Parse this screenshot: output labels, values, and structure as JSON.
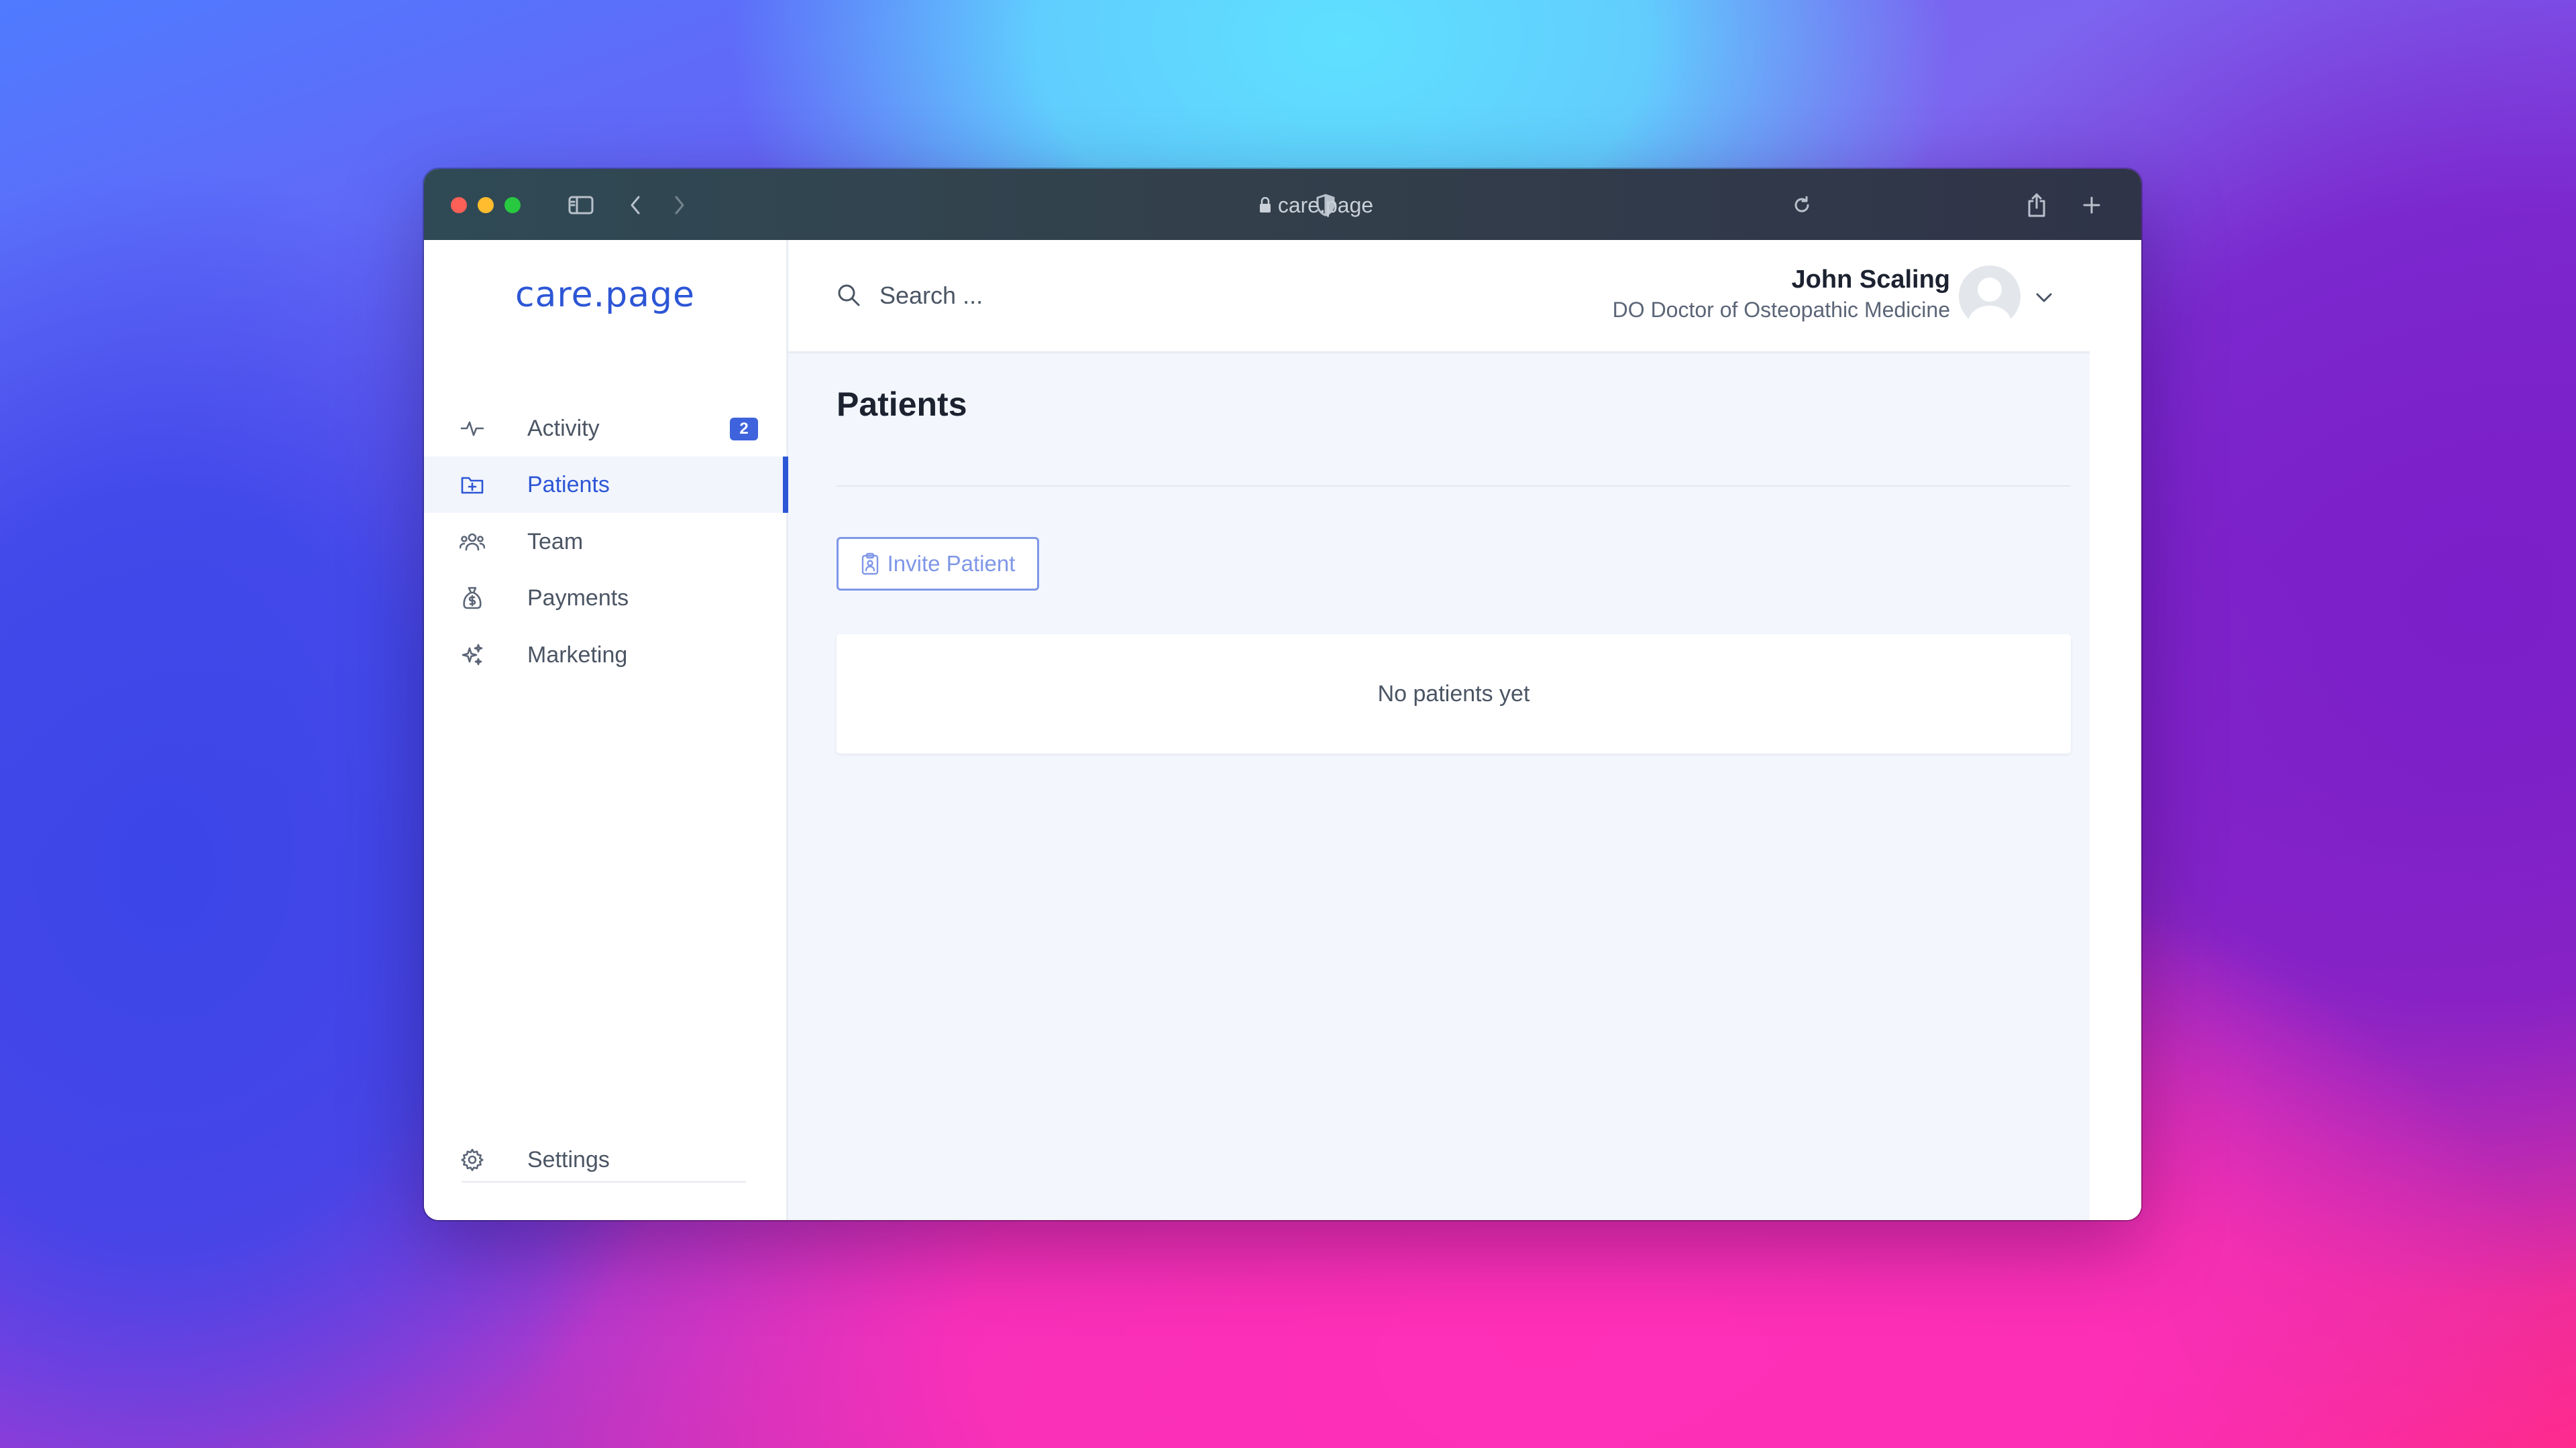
{
  "browser": {
    "url": "care.page"
  },
  "sidebar": {
    "logo": "care.page",
    "items": [
      {
        "label": "Activity",
        "icon": "pulse-icon",
        "badge": "2"
      },
      {
        "label": "Patients",
        "icon": "folder-plus-icon",
        "active": true
      },
      {
        "label": "Team",
        "icon": "users-icon"
      },
      {
        "label": "Payments",
        "icon": "money-bag-icon"
      },
      {
        "label": "Marketing",
        "icon": "sparkles-icon"
      }
    ],
    "settings_label": "Settings"
  },
  "header": {
    "search_placeholder": "Search ...",
    "user_name": "John Scaling",
    "user_role": "DO Doctor of Osteopathic Medicine"
  },
  "main": {
    "title": "Patients",
    "invite_button": "Invite Patient",
    "empty_message": "No patients yet"
  },
  "colors": {
    "accent": "#2d56d6",
    "badge": "#3f63dc",
    "main_background": "#f3f6fc"
  }
}
